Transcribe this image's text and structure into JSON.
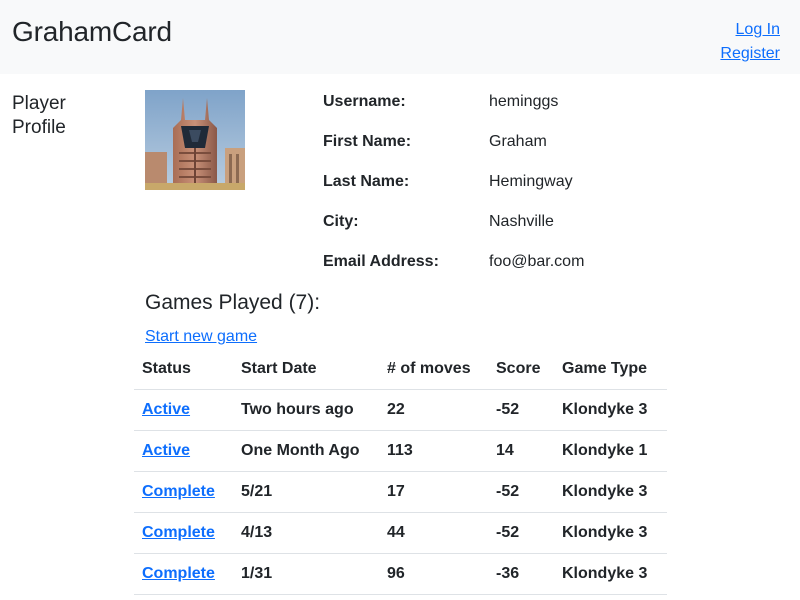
{
  "header": {
    "brand": "GrahamCard",
    "login_label": "Log In",
    "register_label": "Register"
  },
  "sidebar": {
    "title": "Player Profile"
  },
  "profile": {
    "avatar_icon": "building-photo",
    "fields": [
      {
        "label": "Username:",
        "value": "heminggs"
      },
      {
        "label": "First Name:",
        "value": "Graham"
      },
      {
        "label": "Last Name:",
        "value": "Hemingway"
      },
      {
        "label": "City:",
        "value": "Nashville"
      },
      {
        "label": "Email Address:",
        "value": "foo@bar.com"
      }
    ]
  },
  "games": {
    "heading": "Games Played (7):",
    "start_link": "Start new game",
    "columns": [
      "Status",
      "Start Date",
      "# of moves",
      "Score",
      "Game Type"
    ],
    "rows": [
      {
        "status": "Active",
        "start": "Two hours ago",
        "moves": "22",
        "score": "-52",
        "type": "Klondyke 3"
      },
      {
        "status": "Active",
        "start": "One Month Ago",
        "moves": "113",
        "score": "14",
        "type": "Klondyke 1"
      },
      {
        "status": "Complete",
        "start": "5/21",
        "moves": "17",
        "score": "-52",
        "type": "Klondyke 3"
      },
      {
        "status": "Complete",
        "start": "4/13",
        "moves": "44",
        "score": "-52",
        "type": "Klondyke 3"
      },
      {
        "status": "Complete",
        "start": "1/31",
        "moves": "96",
        "score": "-36",
        "type": "Klondyke 3"
      }
    ]
  },
  "colors": {
    "link": "#0d6efd",
    "navbar_bg": "#f8f9fa",
    "text": "#212529",
    "divider": "#dee2e6"
  }
}
